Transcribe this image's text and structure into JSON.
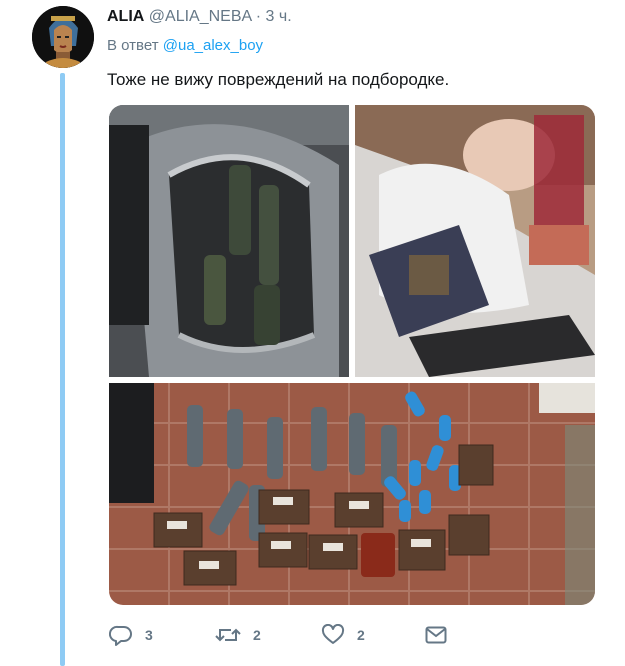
{
  "tweet": {
    "author_name": "ALIA",
    "author_handle": "@ALIA_NEBA",
    "separator": "·",
    "time": "3 ч.",
    "reply_prefix": "В ответ",
    "reply_to": "@ua_alex_boy",
    "text": "Тоже не вижу повреждений на подбородке."
  },
  "actions": {
    "reply_count": "3",
    "retweet_count": "2",
    "like_count": "2"
  },
  "icons": {
    "reply": "reply-icon",
    "retweet": "retweet-icon",
    "like": "heart-icon",
    "message": "envelope-icon"
  },
  "colors": {
    "link": "#1da1f2",
    "secondary_text": "#657786",
    "thread_line": "#8ecbf4"
  }
}
